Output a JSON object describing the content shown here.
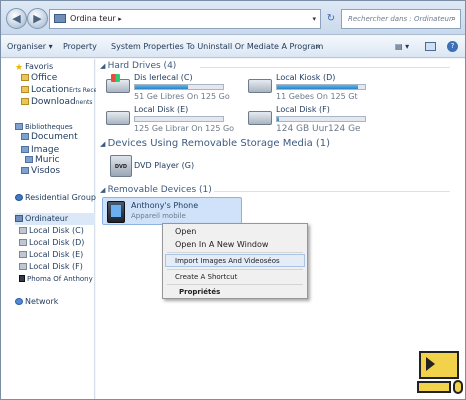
{
  "address": {
    "path": "Ordina teur",
    "search_placeholder": "Rechercher dans : Ordinateur"
  },
  "toolbar": {
    "organize": "Organiser ▾",
    "properties": "Property",
    "system": "System Properties To Uninstall Or Mediate A Program",
    "more": "»",
    "view": "▤ ▾"
  },
  "nav": {
    "favorites_header": "Favoris",
    "favorites": [
      "Office",
      "Location",
      "Download"
    ],
    "favorites_extra": [
      "Erts Reces",
      "nents"
    ],
    "libraries_header": "Bibliotheques",
    "libraries": [
      "Document",
      "Image",
      "Muric",
      "Visdos"
    ],
    "homegroup": "Residential Group",
    "computer_header": "Ordinateur",
    "drives": [
      "Local Disk (C)",
      "Local Disk (D)",
      "Local Disk (E)",
      "Local Disk (F)"
    ],
    "phone": "Phoma Of Anthony",
    "network": "Network"
  },
  "content": {
    "hard_drives_header": "Hard Drives (4)",
    "drives": [
      {
        "name": "Dis lerlecal (C)",
        "free": "51 Ge Libres On 125 Go",
        "fill": 0.6
      },
      {
        "name": "Local Kiosk (D)",
        "free": "11 Gebes On 125 Gt",
        "fill": 0.92
      },
      {
        "name": "Local Disk (E)",
        "free": "125 Ge Librar On 125 Go",
        "fill": 0.0
      },
      {
        "name": "Local Disk (F)",
        "free": "124 GB Uur124 Ge",
        "fill": 0.02
      }
    ],
    "removable_media_header": "Devices Using Removable Storage Media (1)",
    "dvd": {
      "name": "DVD Player (G)",
      "badge": "DVD"
    },
    "removable_devices_header": "Removable Devices (1)",
    "phone": {
      "name": "Anthony's Phone",
      "type": "Appareil mobile"
    }
  },
  "context_menu": {
    "items": [
      "Open",
      "Open In A New Window",
      "Import Images And Videos",
      "Create A Shortcut",
      "Propriétés"
    ],
    "overlay": "éos"
  },
  "colors": {
    "accent": "#2b84c7",
    "selection": "#cfe2fa",
    "logo": "#f2d24a"
  }
}
